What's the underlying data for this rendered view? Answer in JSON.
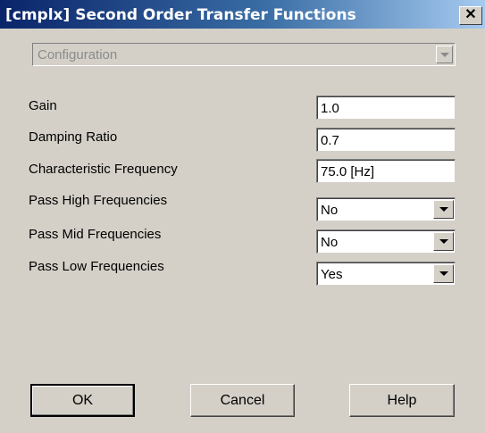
{
  "window": {
    "title": "[cmplx] Second Order Transfer Functions",
    "close_label": "✕"
  },
  "configuration": {
    "value": "Configuration",
    "disabled": true
  },
  "fields": {
    "gain": {
      "label": "Gain",
      "value": "1.0"
    },
    "damping_ratio": {
      "label": "Damping Ratio",
      "value": "0.7"
    },
    "characteristic_frequency": {
      "label": "Characteristic Frequency",
      "value": "75.0 [Hz]"
    },
    "pass_high": {
      "label": "Pass High Frequencies",
      "value": "No"
    },
    "pass_mid": {
      "label": "Pass Mid Frequencies",
      "value": "No"
    },
    "pass_low": {
      "label": "Pass Low Frequencies",
      "value": "Yes"
    }
  },
  "buttons": {
    "ok": "OK",
    "cancel": "Cancel",
    "help": "Help"
  },
  "colors": {
    "title_bar_start": "#0a246a",
    "title_bar_end": "#a6caf0",
    "dialog_face": "#d4d0c8",
    "disabled_text": "#8b8b8b"
  }
}
